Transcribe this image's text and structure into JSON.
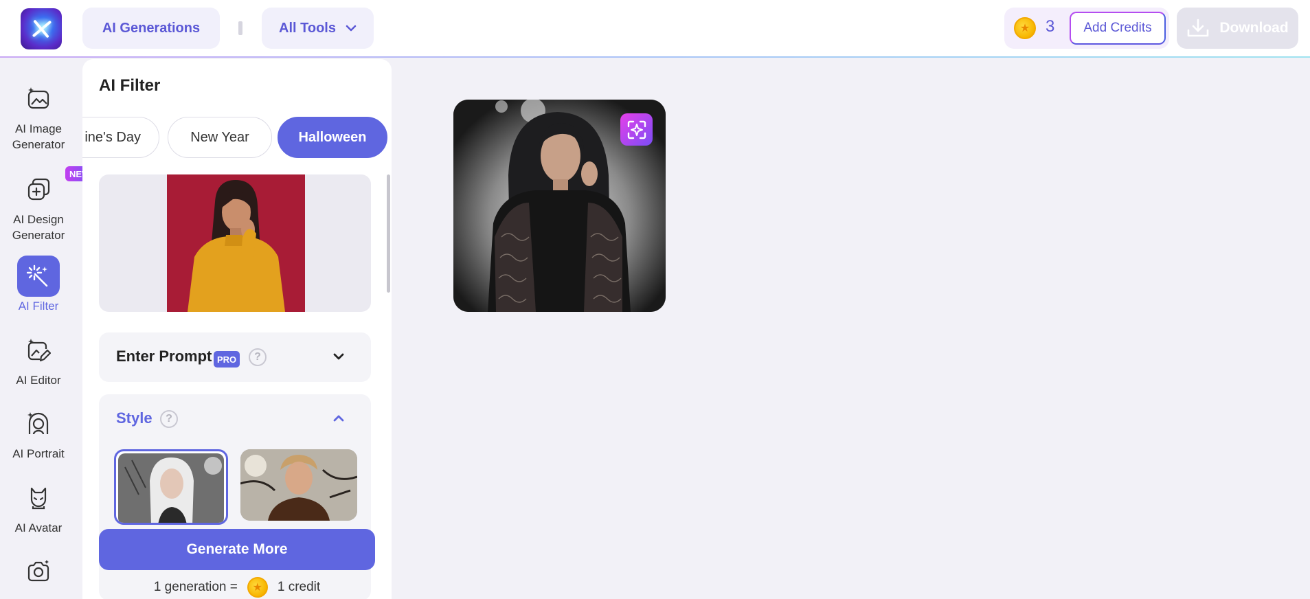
{
  "header": {
    "ai_generations_label": "AI Generations",
    "all_tools_label": "All Tools",
    "credits_count": "3",
    "add_credits_label": "Add Credits",
    "download_label": "Download"
  },
  "rail": {
    "items": [
      {
        "label": "AI Image Generator",
        "icon": "image-sparkle-icon"
      },
      {
        "label": "AI Design Generator",
        "icon": "design-plus-icon",
        "badge": "NEW"
      },
      {
        "label": "AI Filter",
        "icon": "magic-wand-icon",
        "active": true
      },
      {
        "label": "AI Editor",
        "icon": "image-edit-icon"
      },
      {
        "label": "AI Portrait",
        "icon": "portrait-icon"
      },
      {
        "label": "AI Avatar",
        "icon": "avatar-cat-icon"
      },
      {
        "label": "",
        "icon": "camera-icon"
      }
    ]
  },
  "panel": {
    "title": "AI Filter",
    "tabs": [
      {
        "label": "ine's Day",
        "active": false
      },
      {
        "label": "New Year",
        "active": false
      },
      {
        "label": "Halloween",
        "active": true
      }
    ],
    "prompt_section": {
      "title": "Enter Prompt",
      "badge": "PRO"
    },
    "style_section": {
      "title": "Style"
    },
    "generate_label": "Generate More",
    "generation_note": {
      "left": "1 generation =",
      "right": "1 credit"
    }
  },
  "colors": {
    "accent": "#5f66e0",
    "preview_background": "#a81c36",
    "coin": "#f7b500"
  }
}
